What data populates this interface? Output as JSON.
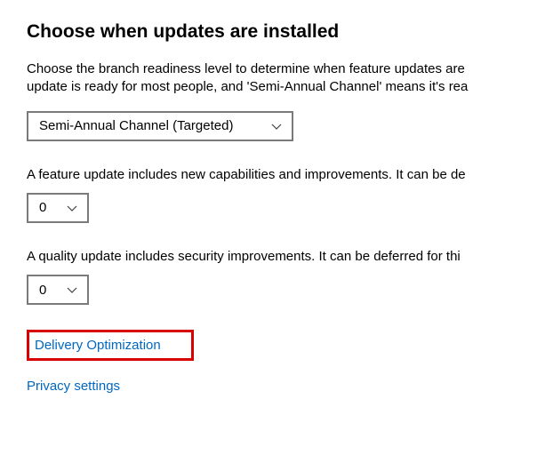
{
  "title": "Choose when updates are installed",
  "intro_line1": "Choose the branch readiness level to determine when feature updates are ",
  "intro_line2": "update is ready for most people, and 'Semi-Annual Channel' means it's rea",
  "branch_dropdown": {
    "value": "Semi-Annual Channel (Targeted)"
  },
  "feature_update": {
    "text": "A feature update includes new capabilities and improvements. It can be de",
    "value": "0"
  },
  "quality_update": {
    "text": "A quality update includes security improvements. It can be deferred for thi",
    "value": "0"
  },
  "links": {
    "delivery_optimization": "Delivery Optimization",
    "privacy_settings": "Privacy settings"
  }
}
